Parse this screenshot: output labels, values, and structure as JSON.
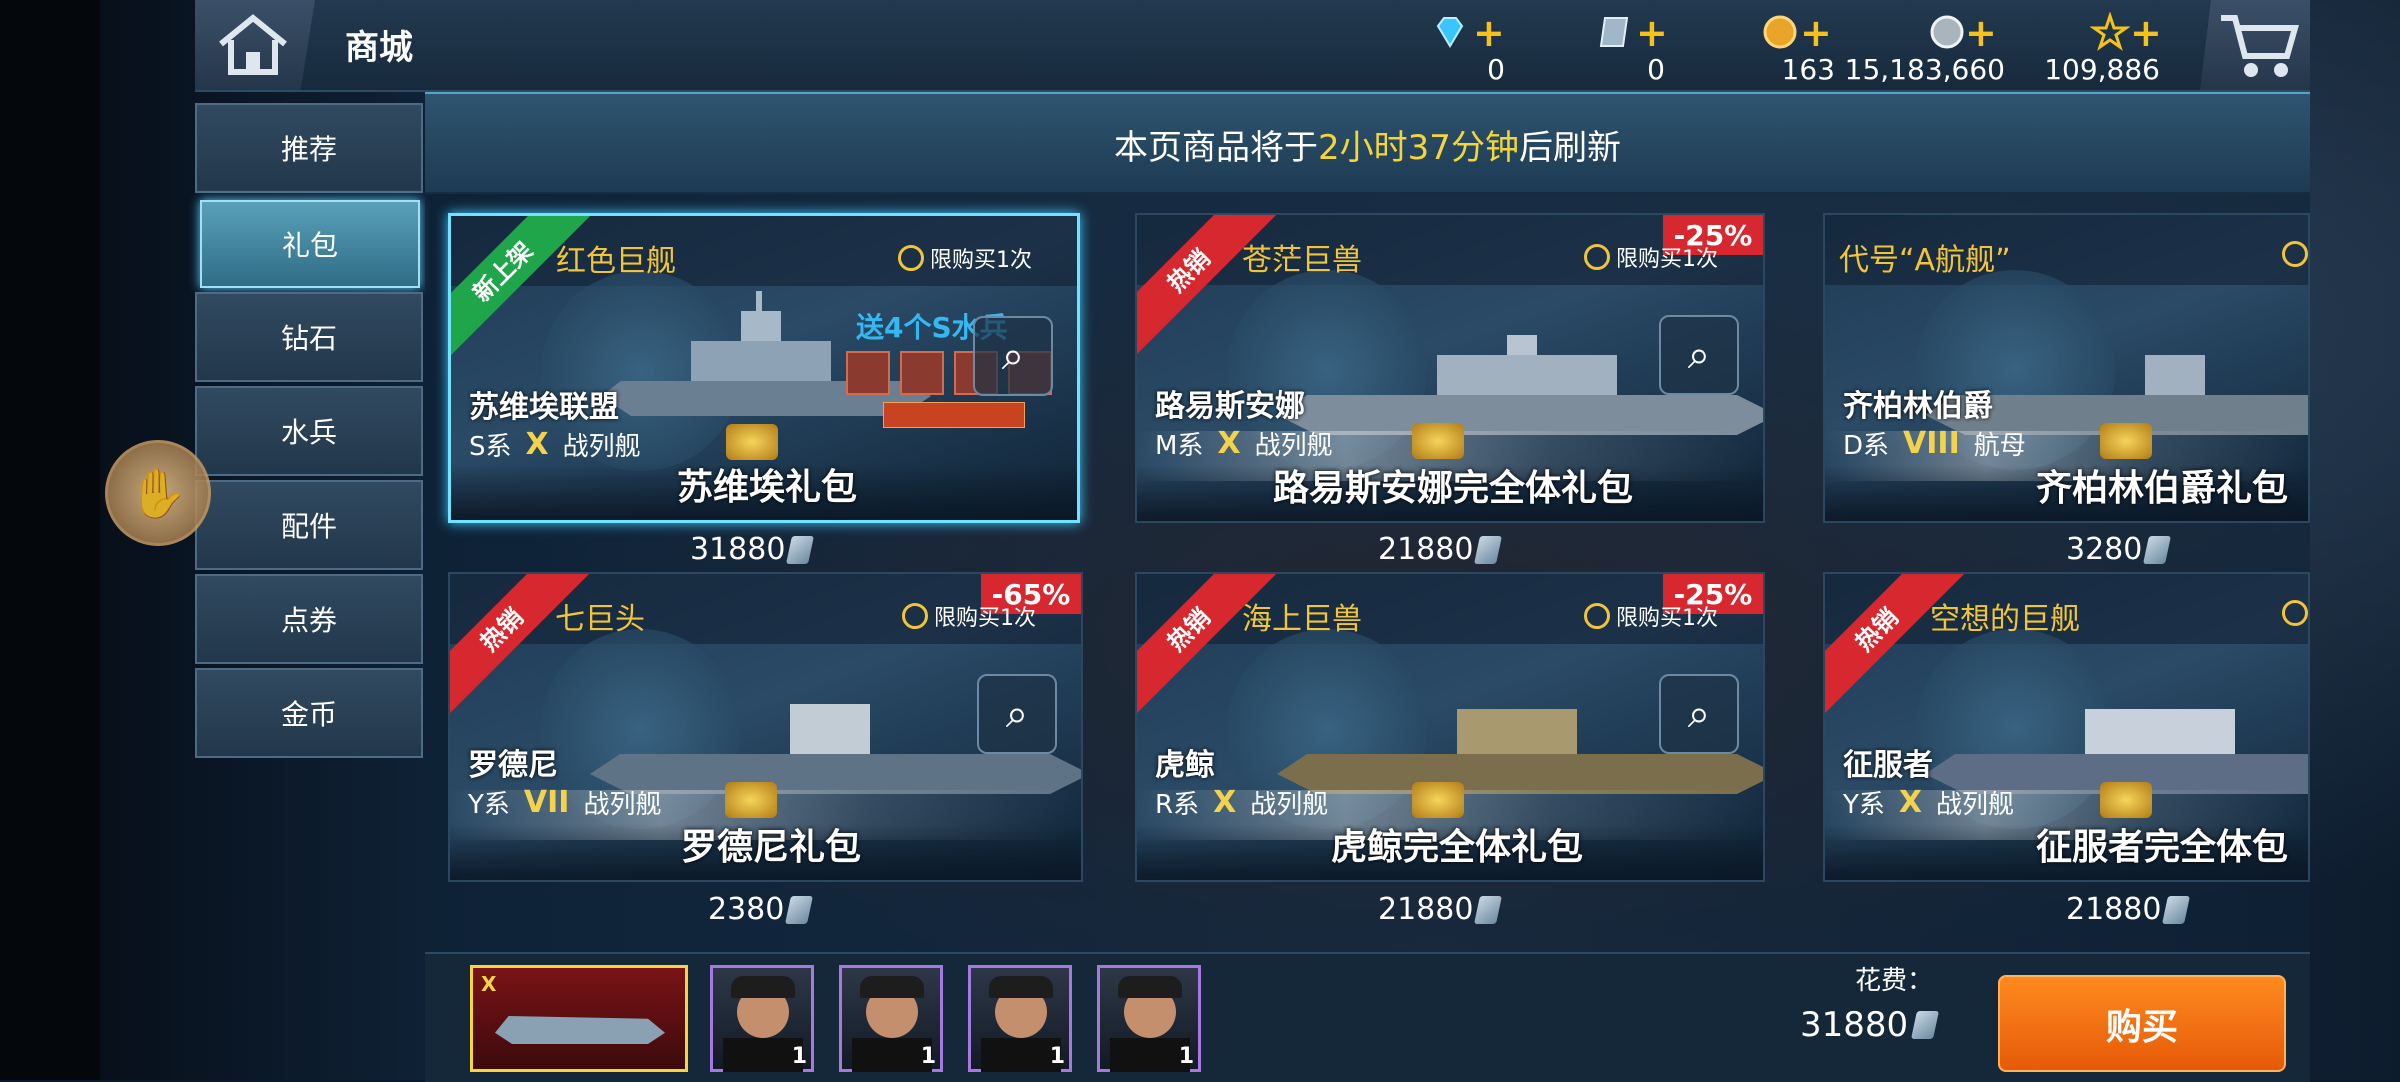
{
  "header": {
    "title": "商城",
    "currencies": [
      {
        "icon": "diamond-icon",
        "value": "0"
      },
      {
        "icon": "ticket-icon",
        "value": "0"
      },
      {
        "icon": "gold-medal-icon",
        "value": "163"
      },
      {
        "icon": "silver-coin-icon",
        "value": "15,183,660"
      },
      {
        "icon": "star-icon",
        "value": "109,886"
      }
    ]
  },
  "nav": {
    "items": [
      "推荐",
      "礼包",
      "钻石",
      "水兵",
      "配件",
      "点券",
      "金币"
    ],
    "active_index": 1
  },
  "banner": {
    "prefix": "本页商品将于",
    "highlight": "2小时37分钟",
    "suffix": "后刷新"
  },
  "cards": [
    {
      "ribbon": "新上架",
      "ribbon_type": "new",
      "title": "红色巨舰",
      "limit": "限购买1次",
      "discount": "",
      "ship_name": "苏维埃联盟",
      "series": "S系",
      "tier": "X",
      "ship_type": "战列舰",
      "pack_name": "苏维埃礼包",
      "price": "31880",
      "promo": "送4个S水兵",
      "selected": true
    },
    {
      "ribbon": "热销",
      "ribbon_type": "hot",
      "title": "苍茫巨兽",
      "limit": "限购买1次",
      "discount": "-25%",
      "ship_name": "路易斯安娜",
      "series": "M系",
      "tier": "X",
      "ship_type": "战列舰",
      "pack_name": "路易斯安娜完全体礼包",
      "price": "21880"
    },
    {
      "ribbon": "",
      "ribbon_type": "",
      "title": "代号“A航舰”",
      "limit": "",
      "discount": "",
      "ship_name": "齐柏林伯爵",
      "series": "D系",
      "tier": "VIII",
      "ship_type": "航母",
      "pack_name": "齐柏林伯爵礼包",
      "price": "3280"
    },
    {
      "ribbon": "热销",
      "ribbon_type": "hot",
      "title": "七巨头",
      "limit": "限购买1次",
      "discount": "-65%",
      "ship_name": "罗德尼",
      "series": "Y系",
      "tier": "VII",
      "ship_type": "战列舰",
      "pack_name": "罗德尼礼包",
      "price": "2380"
    },
    {
      "ribbon": "热销",
      "ribbon_type": "hot",
      "title": "海上巨兽",
      "limit": "限购买1次",
      "discount": "-25%",
      "ship_name": "虎鲸",
      "series": "R系",
      "tier": "X",
      "ship_type": "战列舰",
      "pack_name": "虎鲸完全体礼包",
      "price": "21880"
    },
    {
      "ribbon": "热销",
      "ribbon_type": "hot",
      "title": "空想的巨舰",
      "limit": "",
      "discount": "",
      "ship_name": "征服者",
      "series": "Y系",
      "tier": "X",
      "ship_type": "战列舰",
      "pack_name": "征服者完全体包",
      "price": "21880"
    }
  ],
  "bottom": {
    "selected_ship_tier": "X",
    "crew_counts": [
      "1",
      "1",
      "1",
      "1"
    ],
    "cost_label": "花费：",
    "cost_value": "31880",
    "buy_label": "购买"
  },
  "colors": {
    "highlight": "#f6d53b",
    "hot_ribbon": "#d7272f",
    "new_ribbon": "#1fa54a",
    "buy_button": "#f07212"
  }
}
